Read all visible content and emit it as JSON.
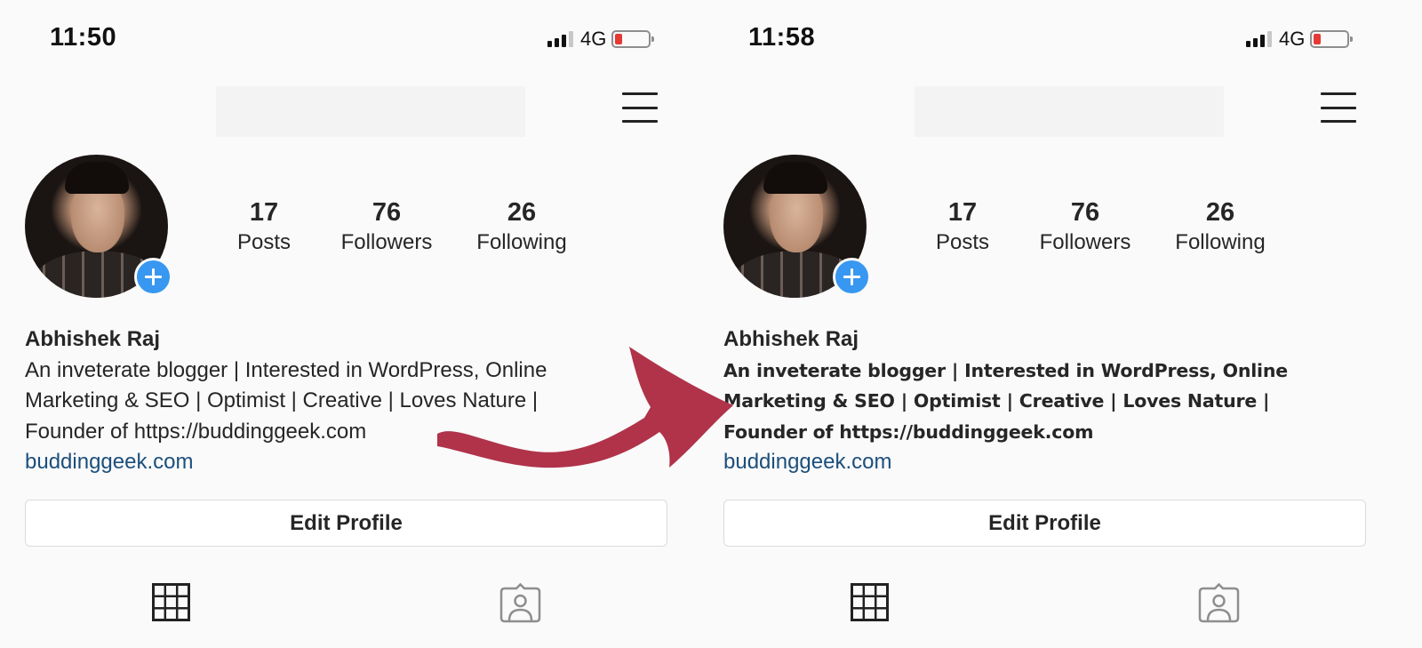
{
  "screens": [
    {
      "status_bar": {
        "time": "11:50",
        "network": "4G",
        "battery_level": 0.15
      },
      "profile": {
        "stats": [
          {
            "value": "17",
            "label": "Posts"
          },
          {
            "value": "76",
            "label": "Followers"
          },
          {
            "value": "26",
            "label": "Following"
          }
        ],
        "name": "Abhishek Raj",
        "bio_lines": [
          "An inveterate blogger | Interested in WordPress, Online",
          "Marketing & SEO | Optimist | Creative | Loves Nature |",
          "Founder of https://buddinggeek.com"
        ],
        "website": "buddinggeek.com",
        "bio_style": "regular"
      },
      "edit_profile_label": "Edit Profile"
    },
    {
      "status_bar": {
        "time": "11:58",
        "network": "4G",
        "battery_level": 0.15
      },
      "profile": {
        "stats": [
          {
            "value": "17",
            "label": "Posts"
          },
          {
            "value": "76",
            "label": "Followers"
          },
          {
            "value": "26",
            "label": "Following"
          }
        ],
        "name": "Abhishek Raj",
        "bio_lines": [
          "An inveterate blogger | Interested in WordPress, Online",
          "Marketing & SEO | Optimist | Creative | Loves Nature |",
          "Founder of https://buddinggeek.com"
        ],
        "website": "buddinggeek.com",
        "bio_style": "bold"
      },
      "edit_profile_label": "Edit Profile"
    }
  ],
  "colors": {
    "background": "#fafafa",
    "text": "#262626",
    "link": "#1c4f7c",
    "add_story_blue": "#3897f0",
    "battery_low": "#e53935",
    "annotation_arrow": "#b0334a"
  },
  "annotation": {
    "type": "arrow",
    "direction": "left-to-right"
  }
}
